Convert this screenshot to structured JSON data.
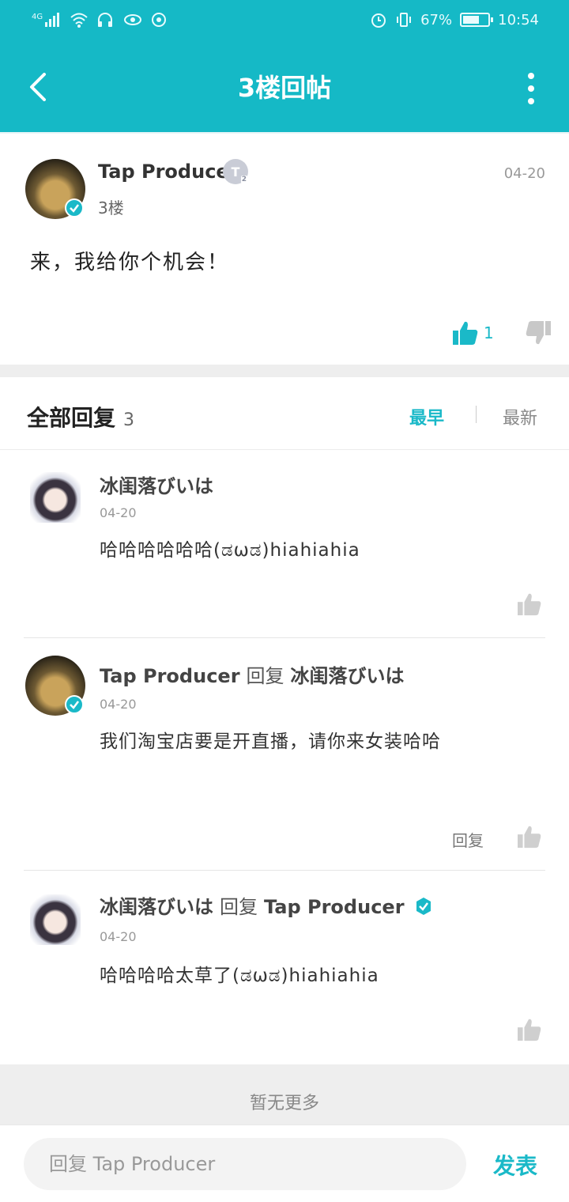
{
  "status_bar": {
    "signal_label": "4G",
    "battery_percent": "67%",
    "battery_level": 0.67,
    "time": "10:54"
  },
  "header": {
    "title": "3楼回帖"
  },
  "post": {
    "author": "Tap Producer",
    "level_badge": "T",
    "level_num": "2",
    "floor": "3楼",
    "date": "04-20",
    "content": "来，我给你个机会！",
    "like_count": "1"
  },
  "replies_section": {
    "title": "全部回复",
    "count": "3",
    "sort_earliest": "最早",
    "sort_latest": "最新"
  },
  "replies": [
    {
      "author": "冰闺落びいは",
      "reply_word": "",
      "reply_to": "",
      "date": "04-20",
      "text": "哈哈哈哈哈哈(ಡωಡ)hiahiahia"
    },
    {
      "author": "Tap Producer",
      "reply_word": "回复",
      "reply_to": "冰闺落びいは",
      "date": "04-20",
      "text": "我们淘宝店要是开直播，请你来女装哈哈",
      "reply_action": "回复"
    },
    {
      "author": "冰闺落びいは",
      "reply_word": "回复",
      "reply_to": "Tap Producer",
      "date": "04-20",
      "text": "哈哈哈哈太草了(ಡωಡ)hiahiahia"
    }
  ],
  "no_more": "暂无更多",
  "bottom_bar": {
    "input_placeholder": "回复 Tap Producer",
    "publish_label": "发表"
  },
  "colors": {
    "accent": "#15b9c6",
    "badge": "#1ab9c8"
  }
}
